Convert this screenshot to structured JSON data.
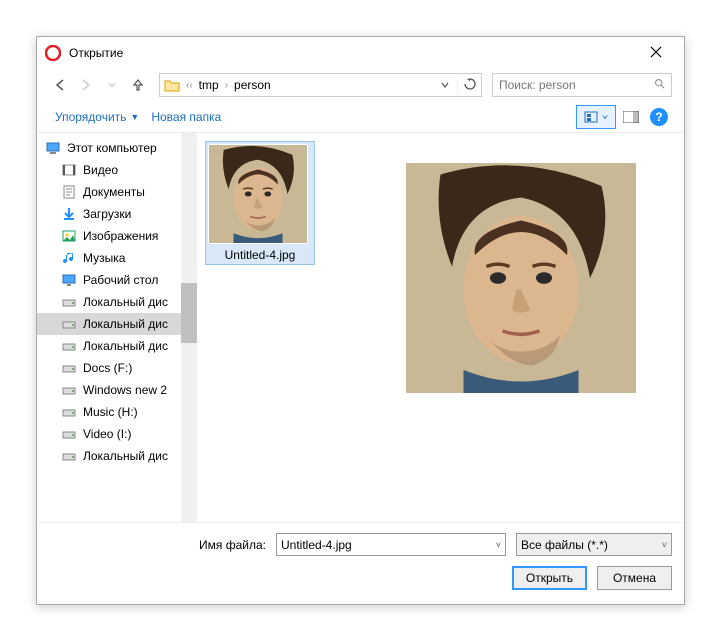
{
  "window": {
    "title": "Открытие"
  },
  "breadcrumb": {
    "parts": [
      "tmp",
      "person"
    ]
  },
  "search": {
    "placeholder": "Поиск: person"
  },
  "toolbar": {
    "organize": "Упорядочить",
    "new_folder": "Новая папка"
  },
  "sidebar": {
    "items": [
      {
        "label": "Этот компьютер",
        "icon": "pc"
      },
      {
        "label": "Видео",
        "icon": "video"
      },
      {
        "label": "Документы",
        "icon": "docs"
      },
      {
        "label": "Загрузки",
        "icon": "download"
      },
      {
        "label": "Изображения",
        "icon": "images"
      },
      {
        "label": "Музыка",
        "icon": "music"
      },
      {
        "label": "Рабочий стол",
        "icon": "desktop"
      },
      {
        "label": "Локальный дис",
        "icon": "drive"
      },
      {
        "label": "Локальный дис",
        "icon": "drive",
        "selected": true
      },
      {
        "label": "Локальный дис",
        "icon": "drive"
      },
      {
        "label": "Docs (F:)",
        "icon": "drive"
      },
      {
        "label": "Windows new 2",
        "icon": "drive"
      },
      {
        "label": "Music (H:)",
        "icon": "drive"
      },
      {
        "label": "Video (I:)",
        "icon": "drive"
      },
      {
        "label": "Локальный дис",
        "icon": "drive"
      }
    ]
  },
  "files": {
    "items": [
      {
        "name": "Untitled-4.jpg"
      }
    ]
  },
  "footer": {
    "filename_label": "Имя файла:",
    "filename_value": "Untitled-4.jpg",
    "filter": "Все файлы (*.*)",
    "open": "Открыть",
    "cancel": "Отмена"
  }
}
